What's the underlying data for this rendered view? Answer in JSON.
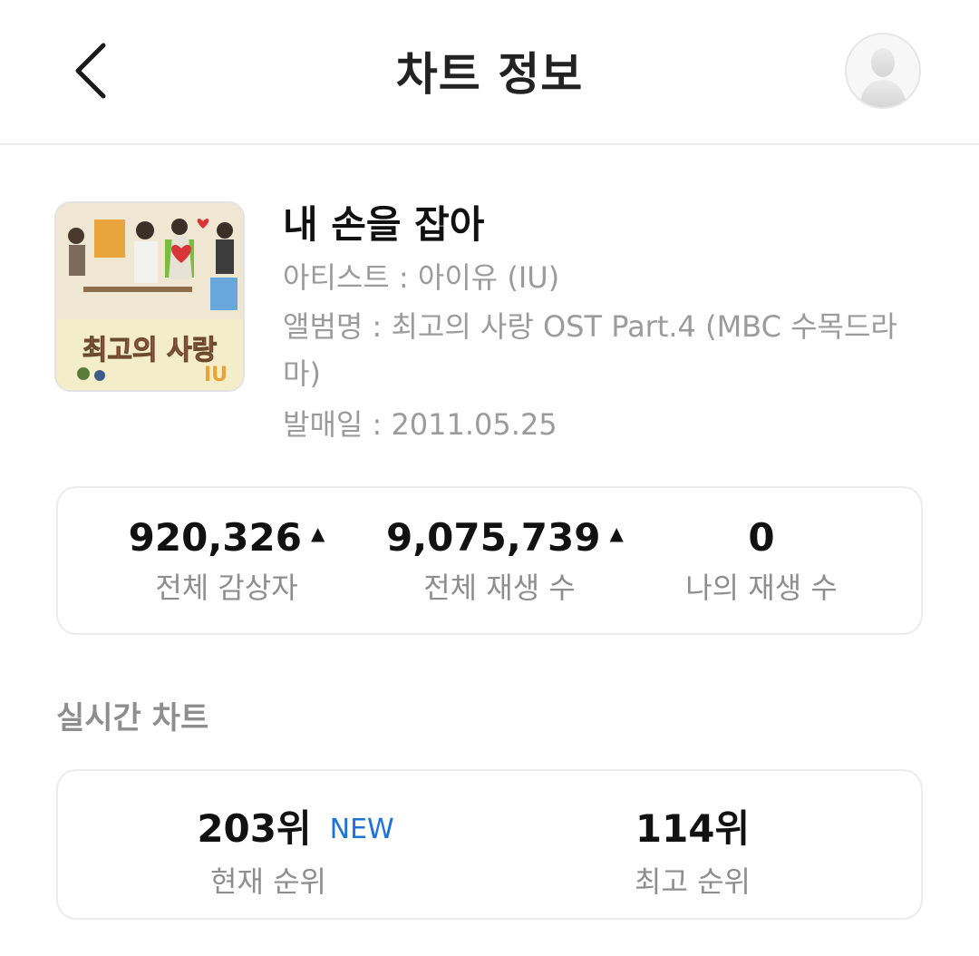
{
  "header": {
    "title": "차트 정보"
  },
  "song": {
    "title": "내 손을 잡아",
    "artist": "아티스트 : 아이유 (IU)",
    "album": "앨범명 : 최고의 사랑 OST Part.4 (MBC 수목드라마)",
    "release_date": "발매일 : 2011.05.25",
    "album_art_text": "최고의 사랑 IU"
  },
  "stats": [
    {
      "value": "920,326",
      "label": "전체 감상자",
      "trend": "up"
    },
    {
      "value": "9,075,739",
      "label": "전체 재생 수",
      "trend": "up"
    },
    {
      "value": "0",
      "label": "나의 재생 수",
      "trend": ""
    }
  ],
  "realtime_chart": {
    "section_title": "실시간 차트",
    "current_rank": "203위",
    "current_badge": "NEW",
    "current_label": "현재 순위",
    "best_rank": "114위",
    "best_label": "최고 순위"
  },
  "colors": {
    "accent_blue": "#1e74d6",
    "muted_text": "#8e8e8e",
    "border": "#ececec"
  },
  "icons": {
    "back": "chevron-left-icon",
    "profile": "avatar-icon",
    "trend_up": "triangle-up-icon"
  }
}
